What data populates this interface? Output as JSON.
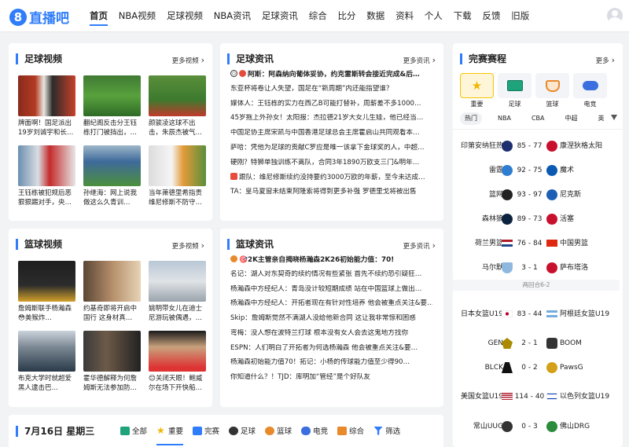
{
  "nav": {
    "logo": "直播吧",
    "items": [
      "首页",
      "NBA视频",
      "足球视频",
      "NBA资讯",
      "足球资讯",
      "综合",
      "比分",
      "数据",
      "资料",
      "个人",
      "下载",
      "反馈",
      "旧版"
    ]
  },
  "soccer_video": {
    "title": "足球视频",
    "more": "更多视频",
    "items": [
      {
        "caption": "牌面啊！国足派出19岁刘诚宇和长…"
      },
      {
        "caption": "翻纪阁反击分王钰栋打门被挡出，…"
      },
      {
        "caption": "颜骏凌这球不出击，朱辰杰被气…"
      },
      {
        "caption": "王钰栋被犯规后恶狠狠踢对手，央…"
      },
      {
        "caption": "孙继海：网上说我做这么久青训…"
      },
      {
        "caption": "当年萧德里希指责维尼修斯不防守…"
      }
    ]
  },
  "soccer_news": {
    "title": "足球资讯",
    "more": "更多资讯",
    "items": [
      "阿斯：阿森纳向葡体妥协，约克雷斯转会接近完成&后…",
      "东亚杯将卷让人失望，国足在“新周期”内还能指望谁？",
      "媒体人：王钰栋的实力在西乙B可能打替补，周薪差不多1000…",
      "45岁拖上外孙女！太阳报：杰拉德21岁大女儿生娃，他已经当…",
      "中国足协主席宋凯与中国香港足球总会主席霍启山共同观看本…",
      "萨哈：凭他为足球的贡献C罗应是唯一该拿下金球奖的人，中超…",
      "硬刚？特狮单独训练不离队，合同3年1890万欧支三门&明年…",
      "跟队：维尼修斯续约没持要约3000万欧的年薪，至今未达成…",
      "TA：皇马夏窗未结束阿隆索将得到更多补强 罗德里戈将被出售"
    ]
  },
  "basket_video": {
    "title": "篮球视频",
    "more": "更多视频",
    "items": [
      {
        "caption": "詹姆斯联手杨瀚森😳美猴炸…"
      },
      {
        "caption": "约基奇即将开启中国行 这身材真…"
      },
      {
        "caption": "姚明带女儿在迪士尼游玩被偶遇，…"
      },
      {
        "caption": "布克大学时就超爱黑人逮击巴…"
      },
      {
        "caption": "霍华德解释为何詹姆斯无法参加防…"
      },
      {
        "caption": "😊关闭天眼！鲍威尔在场下开快船…"
      }
    ]
  },
  "basket_news": {
    "title": "篮球资讯",
    "more": "更多资讯",
    "items": [
      "🎯2K主管亲自揭晓杨瀚森2K26初始能力值：70!",
      "名记：湖人对东契奇的续约情况有些紧张 首先不续约恐引疑狂…",
      "杨瀚森中方经纪人：青岛没计较短期成绩 站在中国篮球上做出…",
      "杨瀚森中方经纪人：开拓者现在有针对性培养 他会被重点关注&要…",
      "Skip：詹姆斯觉然不满湖人没给他新合同 这让我非常惊和困惑",
      "弯梅：没人想在波特兰打球 根本没有女人会去这鬼地方找你",
      "ESPN：人们明白了开拓者为何选杨瀚森 他会被重点关注&要…",
      "杨瀚森初始能力值70！拓记：小杨的传球能力值至少得90…",
      "你知道什么？！TJD：库明加“管经”是个好队友"
    ]
  },
  "schedule": {
    "title": "完赛赛程",
    "more": "更多",
    "sport_tabs": [
      "重要",
      "足球",
      "篮球",
      "电竞"
    ],
    "league_tabs": [
      "热门",
      "NBA",
      "CBA",
      "中超",
      "英"
    ],
    "matches": [
      {
        "home": "印第安纳狂热",
        "score": "85 - 77",
        "away": "康涅狄格太阳",
        "hc": "#1d2f6f",
        "ac": "#c8102e"
      },
      {
        "home": "雷霆",
        "score": "92 - 75",
        "away": "魔术",
        "hc": "#2f7dd1",
        "ac": "#0a5ab2"
      },
      {
        "home": "篮网",
        "score": "93 - 97",
        "away": "尼克斯",
        "hc": "#222222",
        "ac": "#1d5fb5"
      },
      {
        "home": "森林狼",
        "score": "89 - 73",
        "away": "活塞",
        "hc": "#0c2340",
        "ac": "#c8102e"
      },
      {
        "home": "荷兰男篮",
        "score": "76 - 84",
        "away": "中国男篮",
        "hc": "#ae1c28",
        "ac": "#de2910"
      },
      {
        "home": "马尔默",
        "score": "3 - 1",
        "away": "萨布塔洛",
        "hc": "#8fb8de",
        "ac": "#c8102e"
      },
      {
        "home": "日本女篮U19",
        "score": "83 - 44",
        "away": "阿根廷女篮U19",
        "hc": "#ffffff",
        "ac": "#74acdf"
      },
      {
        "home": "GEN",
        "score": "2 - 1",
        "away": "BOOM",
        "hc": "#aa8a00",
        "ac": "#333333"
      },
      {
        "home": "BLCK",
        "score": "0 - 2",
        "away": "PawsG",
        "hc": "#111111",
        "ac": "#d4a017"
      },
      {
        "home": "美国女篮U19",
        "score": "114 - 40",
        "away": "以色列女篮U19",
        "hc": "#3c3b6e",
        "ac": "#0038b8"
      },
      {
        "home": "常山UUG",
        "score": "0 - 3",
        "away": "佛山DRG",
        "hc": "#333333",
        "ac": "#2a8c3c"
      }
    ],
    "round_label": "两回合6-2"
  },
  "bottom": {
    "date": "7月16日 星期三",
    "tabs": [
      "全部",
      "重要",
      "完赛",
      "足球",
      "篮球",
      "电竞",
      "综合",
      "筛选"
    ]
  }
}
